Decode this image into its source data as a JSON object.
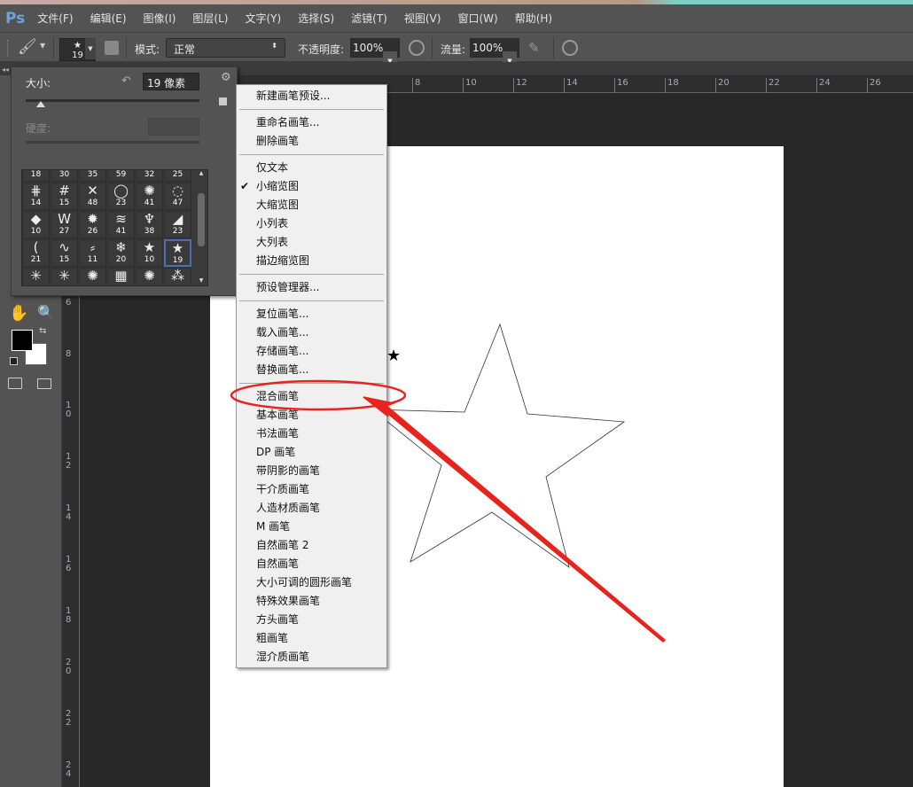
{
  "app": {
    "logo": "Ps"
  },
  "menu": [
    "文件(F)",
    "编辑(E)",
    "图像(I)",
    "图层(L)",
    "文字(Y)",
    "选择(S)",
    "滤镜(T)",
    "视图(V)",
    "窗口(W)",
    "帮助(H)"
  ],
  "options": {
    "brush_size": "19",
    "mode_label": "模式:",
    "mode_value": "正常",
    "opacity_label": "不透明度:",
    "opacity_value": "100%",
    "flow_label": "流量:",
    "flow_value": "100%"
  },
  "brush_panel": {
    "size_label": "大小:",
    "size_value": "19 像素",
    "hardness_label": "硬度:",
    "size_slider_fraction": 0.06,
    "rows": [
      [
        "18",
        "30",
        "35",
        "59",
        "32",
        "25"
      ],
      [
        "14",
        "15",
        "48",
        "23",
        "41",
        "47"
      ],
      [
        "10",
        "27",
        "26",
        "41",
        "38",
        "23"
      ],
      [
        "21",
        "15",
        "11",
        "20",
        "10",
        "19"
      ],
      [
        "",
        "",
        "",
        "",
        "",
        ""
      ]
    ],
    "glyphs": [
      [
        "◡",
        "◡",
        "◡",
        "◡",
        "◡",
        "◡"
      ],
      [
        "⋕",
        "#",
        "✕",
        "◯",
        "✺",
        "◌"
      ],
      [
        "◆",
        "W",
        "✹",
        "≋",
        "♆",
        "◢"
      ],
      [
        "(",
        "∿",
        "⸗",
        "❄",
        "★",
        "★"
      ],
      [
        "✳",
        "✳",
        "✺",
        "▦",
        "✺",
        "⁂"
      ]
    ],
    "selected": [
      3,
      5
    ]
  },
  "context_menu": [
    {
      "label": "新建画笔预设..."
    },
    {
      "sep": true
    },
    {
      "label": "重命名画笔..."
    },
    {
      "label": "删除画笔"
    },
    {
      "sep": true
    },
    {
      "label": "仅文本"
    },
    {
      "label": "小缩览图",
      "checked": true
    },
    {
      "label": "大缩览图"
    },
    {
      "label": "小列表"
    },
    {
      "label": "大列表"
    },
    {
      "label": "描边缩览图"
    },
    {
      "sep": true
    },
    {
      "label": "预设管理器..."
    },
    {
      "sep": true
    },
    {
      "label": "复位画笔..."
    },
    {
      "label": "载入画笔..."
    },
    {
      "label": "存储画笔..."
    },
    {
      "label": "替换画笔..."
    },
    {
      "sep": true
    },
    {
      "label": "混合画笔",
      "highlighted": true
    },
    {
      "label": "基本画笔"
    },
    {
      "label": "书法画笔"
    },
    {
      "label": "DP 画笔"
    },
    {
      "label": "带阴影的画笔"
    },
    {
      "label": "干介质画笔"
    },
    {
      "label": "人造材质画笔"
    },
    {
      "label": "M 画笔"
    },
    {
      "label": "自然画笔 2"
    },
    {
      "label": "自然画笔"
    },
    {
      "label": "大小可调的圆形画笔"
    },
    {
      "label": "特殊效果画笔"
    },
    {
      "label": "方头画笔"
    },
    {
      "label": "粗画笔"
    },
    {
      "label": "湿介质画笔"
    }
  ],
  "hruler": [
    "8",
    "10",
    "12",
    "14",
    "16",
    "18",
    "20",
    "22",
    "24",
    "26"
  ],
  "vruler": [
    "6",
    "8",
    "1\n0",
    "1\n2",
    "1\n4",
    "1\n6",
    "1\n8",
    "2\n0",
    "2\n2",
    "2\n4"
  ],
  "colors": {
    "annotation": "#e8231e",
    "foreground": "#000000",
    "background": "#ffffff"
  }
}
